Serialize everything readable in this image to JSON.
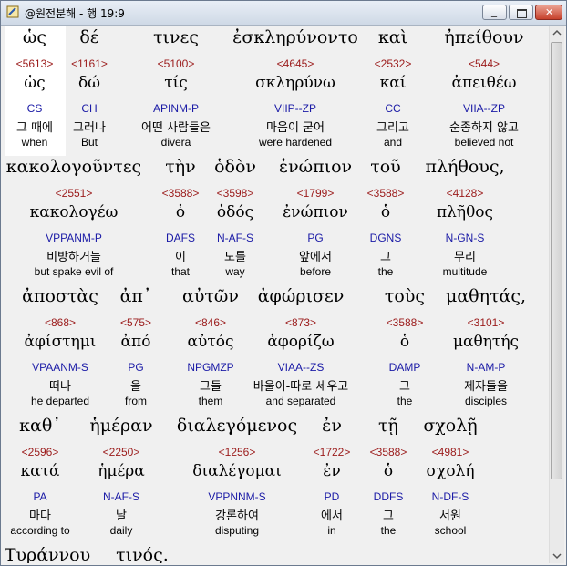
{
  "window": {
    "title": "@원전분해 - 행 19:9"
  },
  "rows": [
    {
      "words": [
        {
          "greek": "ὡς",
          "strong": "<5613>",
          "lemma": "ὡς",
          "parse": "CS",
          "korean": "그 때에",
          "english": "when"
        },
        {
          "greek": "δέ",
          "strong": "<1161>",
          "lemma": "δώ",
          "parse": "CH",
          "korean": "그러나",
          "english": "But"
        },
        {
          "greek": "τινες",
          "strong": "<5100>",
          "lemma": "τίς",
          "parse": "APINM-P",
          "korean": "어떤 사람들은",
          "english": "divera"
        },
        {
          "greek": "ἐσκληρύνοντο",
          "strong": "<4645>",
          "lemma": "σκληρύνω",
          "parse": "VIIP--ZP",
          "korean": "마음이 굳어",
          "english": "were hardened"
        },
        {
          "greek": "καὶ",
          "strong": "<2532>",
          "lemma": "καί",
          "parse": "CC",
          "korean": "그리고",
          "english": "and"
        },
        {
          "greek": "ἠπείθουν",
          "strong": "<544>",
          "lemma": "ἀπειθέω",
          "parse": "VIIA--ZP",
          "korean": "순종하지 않고",
          "english": "believed not"
        }
      ]
    },
    {
      "words": [
        {
          "greek": "κακολογοῦντες",
          "strong": "<2551>",
          "lemma": "κακολογέω",
          "parse": "VPPANM-P",
          "korean": "비방하거늘",
          "english": "but spake evil of"
        },
        {
          "greek": "τὴν",
          "strong": "<3588>",
          "lemma": "ὁ",
          "parse": "DAFS",
          "korean": "이",
          "english": "that"
        },
        {
          "greek": "ὁδὸν",
          "strong": "<3598>",
          "lemma": "ὁδός",
          "parse": "N-AF-S",
          "korean": "도를",
          "english": "way"
        },
        {
          "greek": "ἐνώπιον",
          "strong": "<1799>",
          "lemma": "ἐνώπιον",
          "parse": "PG",
          "korean": "앞에서",
          "english": "before"
        },
        {
          "greek": "τοῦ",
          "strong": "<3588>",
          "lemma": "ὁ",
          "parse": "DGNS",
          "korean": "그",
          "english": "the"
        },
        {
          "greek": "πλήθους,",
          "strong": "<4128>",
          "lemma": "πλῆθος",
          "parse": "N-GN-S",
          "korean": "무리",
          "english": "multitude"
        }
      ]
    },
    {
      "words": [
        {
          "greek": "ἀποστὰς",
          "strong": "<868>",
          "lemma": "ἀφίστημι",
          "parse": "VPAANM-S",
          "korean": "떠나",
          "english": "he departed"
        },
        {
          "greek": "ἀπ᾽",
          "strong": "<575>",
          "lemma": "ἀπό",
          "parse": "PG",
          "korean": "을",
          "english": "from"
        },
        {
          "greek": "αὐτῶν",
          "strong": "<846>",
          "lemma": "αὐτός",
          "parse": "NPGMZP",
          "korean": "그들",
          "english": "them"
        },
        {
          "greek": "ἀφώρισεν",
          "strong": "<873>",
          "lemma": "ἀφορίζω",
          "parse": "VIAA--ZS",
          "korean": "바울이-따로 세우고",
          "english": "and separated"
        },
        {
          "greek": "τοὺς",
          "strong": "<3588>",
          "lemma": "ὁ",
          "parse": "DAMP",
          "korean": "그",
          "english": "the"
        },
        {
          "greek": "μαθητάς,",
          "strong": "<3101>",
          "lemma": "μαθητής",
          "parse": "N-AM-P",
          "korean": "제자들을",
          "english": "disciples"
        }
      ]
    },
    {
      "words": [
        {
          "greek": "καθ᾽",
          "strong": "<2596>",
          "lemma": "κατά",
          "parse": "PA",
          "korean": "마다",
          "english": "according to"
        },
        {
          "greek": "ἡμέραν",
          "strong": "<2250>",
          "lemma": "ἡμέρα",
          "parse": "N-AF-S",
          "korean": "날",
          "english": "daily"
        },
        {
          "greek": "διαλεγόμενος",
          "strong": "<1256>",
          "lemma": "διαλέγομαι",
          "parse": "VPPNNM-S",
          "korean": "강론하여",
          "english": "disputing"
        },
        {
          "greek": "ἐν",
          "strong": "<1722>",
          "lemma": "ἐν",
          "parse": "PD",
          "korean": "에서",
          "english": "in"
        },
        {
          "greek": "τῇ",
          "strong": "<3588>",
          "lemma": "ὁ",
          "parse": "DDFS",
          "korean": "그",
          "english": "the"
        },
        {
          "greek": "σχολῇ",
          "strong": "<4981>",
          "lemma": "σχολή",
          "parse": "N-DF-S",
          "korean": "서원",
          "english": "school"
        }
      ]
    },
    {
      "words": [
        {
          "greek": "Τυράννου",
          "strong": "",
          "lemma": "",
          "parse": "",
          "korean": "",
          "english": ""
        },
        {
          "greek": "τινός.",
          "strong": "",
          "lemma": "",
          "parse": "",
          "korean": "",
          "english": ""
        }
      ]
    }
  ]
}
